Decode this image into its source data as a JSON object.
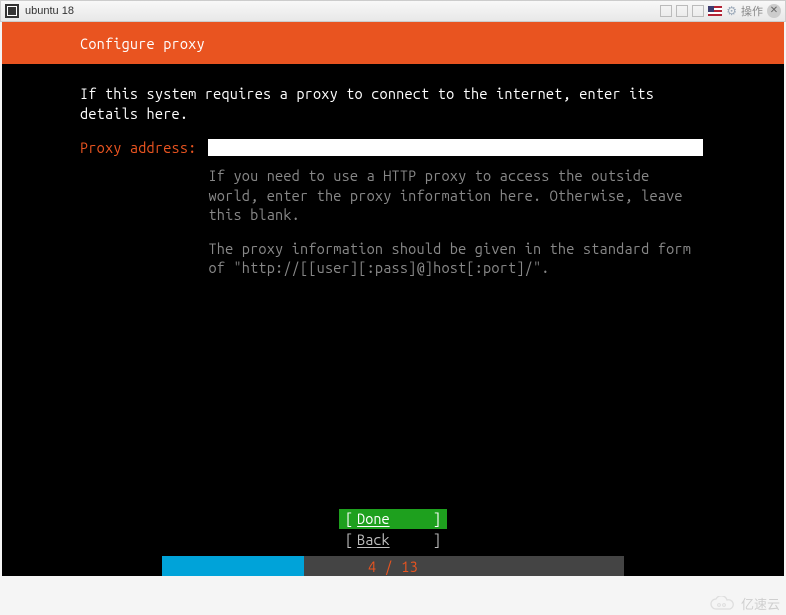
{
  "window": {
    "title": "ubuntu 18",
    "operations_label": "操作"
  },
  "header": {
    "title": "Configure proxy"
  },
  "instruction": "If this system requires a proxy to connect to the internet, enter its details here.",
  "form": {
    "proxy_label": "Proxy address:",
    "proxy_value": "",
    "help_p1": "If you need to use a HTTP proxy to access the outside world, enter the proxy information here. Otherwise, leave this blank.",
    "help_p2": "The proxy information should be given in the standard form of \"http://[[user][:pass]@]host[:port]/\"."
  },
  "buttons": {
    "done": "Done",
    "back": "Back"
  },
  "progress": {
    "current": 4,
    "total": 13,
    "text": "4 / 13",
    "percent": 30.77
  },
  "watermark": "亿速云"
}
